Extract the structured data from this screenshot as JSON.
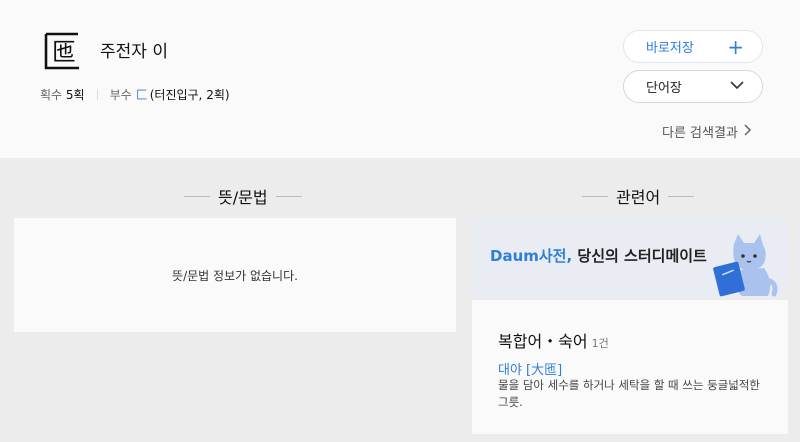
{
  "word": {
    "hanja": "匜",
    "title": "주전자 이",
    "stroke_label": "획수",
    "stroke_value": "5획",
    "radical_label": "부수",
    "radical_char": "匚",
    "radical_info": "(터진입구, 2획)"
  },
  "actions": {
    "save_label": "바로저장",
    "save_icon": "+",
    "vocab_label": "단어장",
    "more_results": "다른 검색결과"
  },
  "sections": {
    "meaning_title": "뜻/문법",
    "meaning_empty": "뜻/문법 정보가 없습니다.",
    "related_title": "관련어"
  },
  "banner": {
    "brand": "Daum사전,",
    "tagline": "당신의 스터디메이트"
  },
  "related": {
    "category": "복합어・숙어",
    "count": "1건",
    "items": [
      {
        "word": "대야 [大匜]",
        "definition": "물을 담아 세수를 하거나 세탁을 할 때 쓰는 둥글넓적한 그릇."
      }
    ]
  },
  "colors": {
    "accent": "#2f7ed8",
    "page_bg": "#ececec",
    "card_bg": "#fafafa",
    "banner_bg": "#e9ecf3"
  }
}
